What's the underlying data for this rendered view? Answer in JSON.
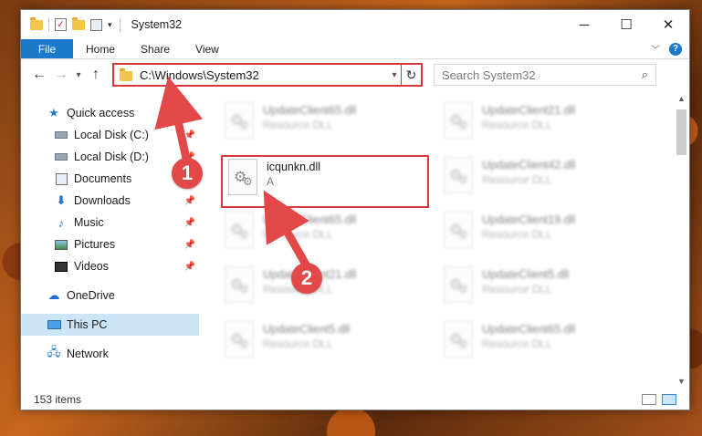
{
  "window": {
    "title": "System32",
    "controls": {
      "minimize": "─",
      "maximize": "☐",
      "close": "✕"
    }
  },
  "ribbon": {
    "tabs": [
      "File",
      "Home",
      "Share",
      "View"
    ],
    "help": "?"
  },
  "address": {
    "path": "C:\\Windows\\System32",
    "search_placeholder": "Search System32"
  },
  "sidebar": {
    "items": [
      {
        "label": "Quick access",
        "icon": "star-icon"
      },
      {
        "label": "Local Disk (C:)",
        "icon": "drive-icon"
      },
      {
        "label": "Local Disk (D:)",
        "icon": "drive-icon"
      },
      {
        "label": "Documents",
        "icon": "documents-icon"
      },
      {
        "label": "Downloads",
        "icon": "downloads-icon"
      },
      {
        "label": "Music",
        "icon": "music-icon"
      },
      {
        "label": "Pictures",
        "icon": "pictures-icon"
      },
      {
        "label": "Videos",
        "icon": "videos-icon"
      },
      {
        "label": "OneDrive",
        "icon": "onedrive-icon"
      },
      {
        "label": "This PC",
        "icon": "this-pc-icon"
      },
      {
        "label": "Network",
        "icon": "network-icon"
      }
    ]
  },
  "files": [
    {
      "name": "UpdateClient65.dll",
      "type": "Resource DLL"
    },
    {
      "name": "UpdateClient21.dll",
      "type": "Resource DLL"
    },
    {
      "name": "icqunkn.dll",
      "type": "A"
    },
    {
      "name": "UpdateClient42.dll",
      "type": "Resource DLL"
    },
    {
      "name": "UpdateClient65.dll",
      "type": "Resource DLL"
    },
    {
      "name": "UpdateClient19.dll",
      "type": "Resource DLL"
    },
    {
      "name": "UpdateClient21.dll",
      "type": "Resource DLL"
    },
    {
      "name": "UpdateClient5.dll",
      "type": "Resource DLL"
    },
    {
      "name": "UpdateClient5.dll",
      "type": "Resource DLL"
    },
    {
      "name": "UpdateClient65.dll",
      "type": "Resource DLL"
    }
  ],
  "status": {
    "count": "153 items"
  },
  "annotations": {
    "step1": "1",
    "step2": "2",
    "color": "#e24848"
  }
}
